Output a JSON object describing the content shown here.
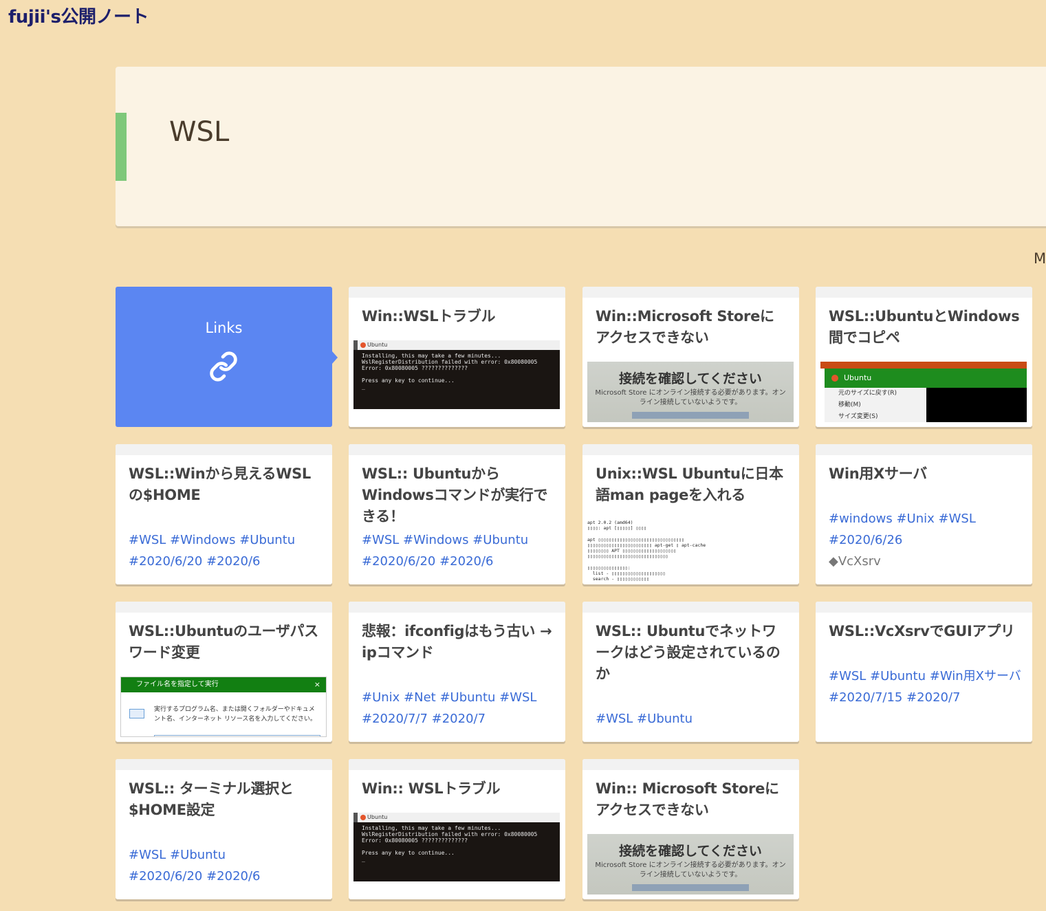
{
  "site": {
    "title": "fujii's公開ノート"
  },
  "page": {
    "title": "WSL",
    "more_label": "M"
  },
  "links_card": {
    "label": "Links",
    "icon": "link-icon"
  },
  "cards": [
    {
      "title": "Win::WSLトラブル",
      "thumb": "terminal"
    },
    {
      "title": "Win::Microsoft Storeにアクセスできない",
      "thumb": "store"
    },
    {
      "title": "WSL::UbuntuとWindows間でコピペ",
      "thumb": "ubuntu"
    },
    {
      "title": "WSL::Winから見えるWSLの$HOME",
      "tags_line1": "#WSL #Windows #Ubuntu",
      "tags_line2": "#2020/6/20 #2020/6"
    },
    {
      "title": "WSL:: UbuntuからWindowsコマンドが実行できる！",
      "tags_line1": "#WSL #Windows #Ubuntu",
      "tags_line2": "#2020/6/20 #2020/6"
    },
    {
      "title": "Unix::WSL Ubuntuに日本語man pageを入れる",
      "thumb": "man"
    },
    {
      "title": "Win用Xサーバ",
      "tags_line1": "#windows #Unix #WSL",
      "tags_line2": "#2020/6/26",
      "extra": "◆VcXsrv"
    },
    {
      "title": "WSL::Ubuntuのユーザパスワード変更",
      "thumb": "run"
    },
    {
      "title": "悲報：ifconfigはもう古い → ipコマンド",
      "tags_line1": "#Unix #Net #Ubuntu #WSL",
      "tags_line2": "#2020/7/7 #2020/7"
    },
    {
      "title": "WSL:: Ubuntuでネットワークはどう設定されているのか",
      "tags_line1": "#WSL #Ubuntu"
    },
    {
      "title": "WSL::VcXsrvでGUIアプリ",
      "tags_line1": "#WSL #Ubuntu #Win用Xサーバ",
      "tags_line2": "#2020/7/15 #2020/7"
    },
    {
      "title": "WSL:: ターミナル選択と$HOME設定",
      "tags_line1": "#WSL #Ubuntu",
      "tags_line2": "#2020/6/20 #2020/6"
    },
    {
      "title": "Win:: WSLトラブル",
      "thumb": "terminal"
    },
    {
      "title": "Win:: Microsoft Storeにアクセスできない",
      "thumb": "store"
    }
  ],
  "thumbs": {
    "terminal": {
      "window_title": "Ubuntu",
      "text": "Installing, this may take a few minutes...\nWslRegisterDistribution failed with error: 0x80080005\nError: 0x80080005 ??????????????\n\nPress any key to continue...\n_"
    },
    "store": {
      "heading": "接続を確認してください",
      "body": "Microsoft Store にオンライン接続する必要があります。オンライン接続していないようです。"
    },
    "ubuntu": {
      "window_title": "Ubuntu",
      "menu": [
        "元のサイズに戻す(R)",
        "移動(M)",
        "サイズ変更(S)"
      ]
    },
    "man": {
      "text": "apt 2.0.2 (amd64)\n▯▯▯▯: apt [▯▯▯▯▯] ▯▯▯▯\n\napt ▯▯▯▯▯▯▯▯▯▯▯▯▯▯▯▯▯▯▯▯▯▯▯▯▯▯▯▯▯▯▯▯\n▯▯▯▯▯▯▯▯▯▯▯▯▯▯▯▯▯▯▯▯▯▯▯▯ apt-get ▯ apt-cache\n▯▯▯▯▯▯▯▯ APT ▯▯▯▯▯▯▯▯▯▯▯▯▯▯▯▯▯▯▯▯\n▯▯▯▯▯▯▯▯▯▯▯▯▯▯▯▯▯▯▯▯▯▯▯▯▯▯▯▯▯▯\n\n▯▯▯▯▯▯▯▯▯▯▯▯▯▯▯:\n  list - ▯▯▯▯▯▯▯▯▯▯▯▯▯▯▯▯▯▯▯▯\n  search - ▯▯▯▯▯▯▯▯▯▯▯▯"
    },
    "run": {
      "window_title": "ファイル名を指定して実行",
      "close": "×",
      "body": "実行するプログラム名、または開くフォルダーやドキュメント名、インターネット リソース名を入力してください。"
    }
  }
}
